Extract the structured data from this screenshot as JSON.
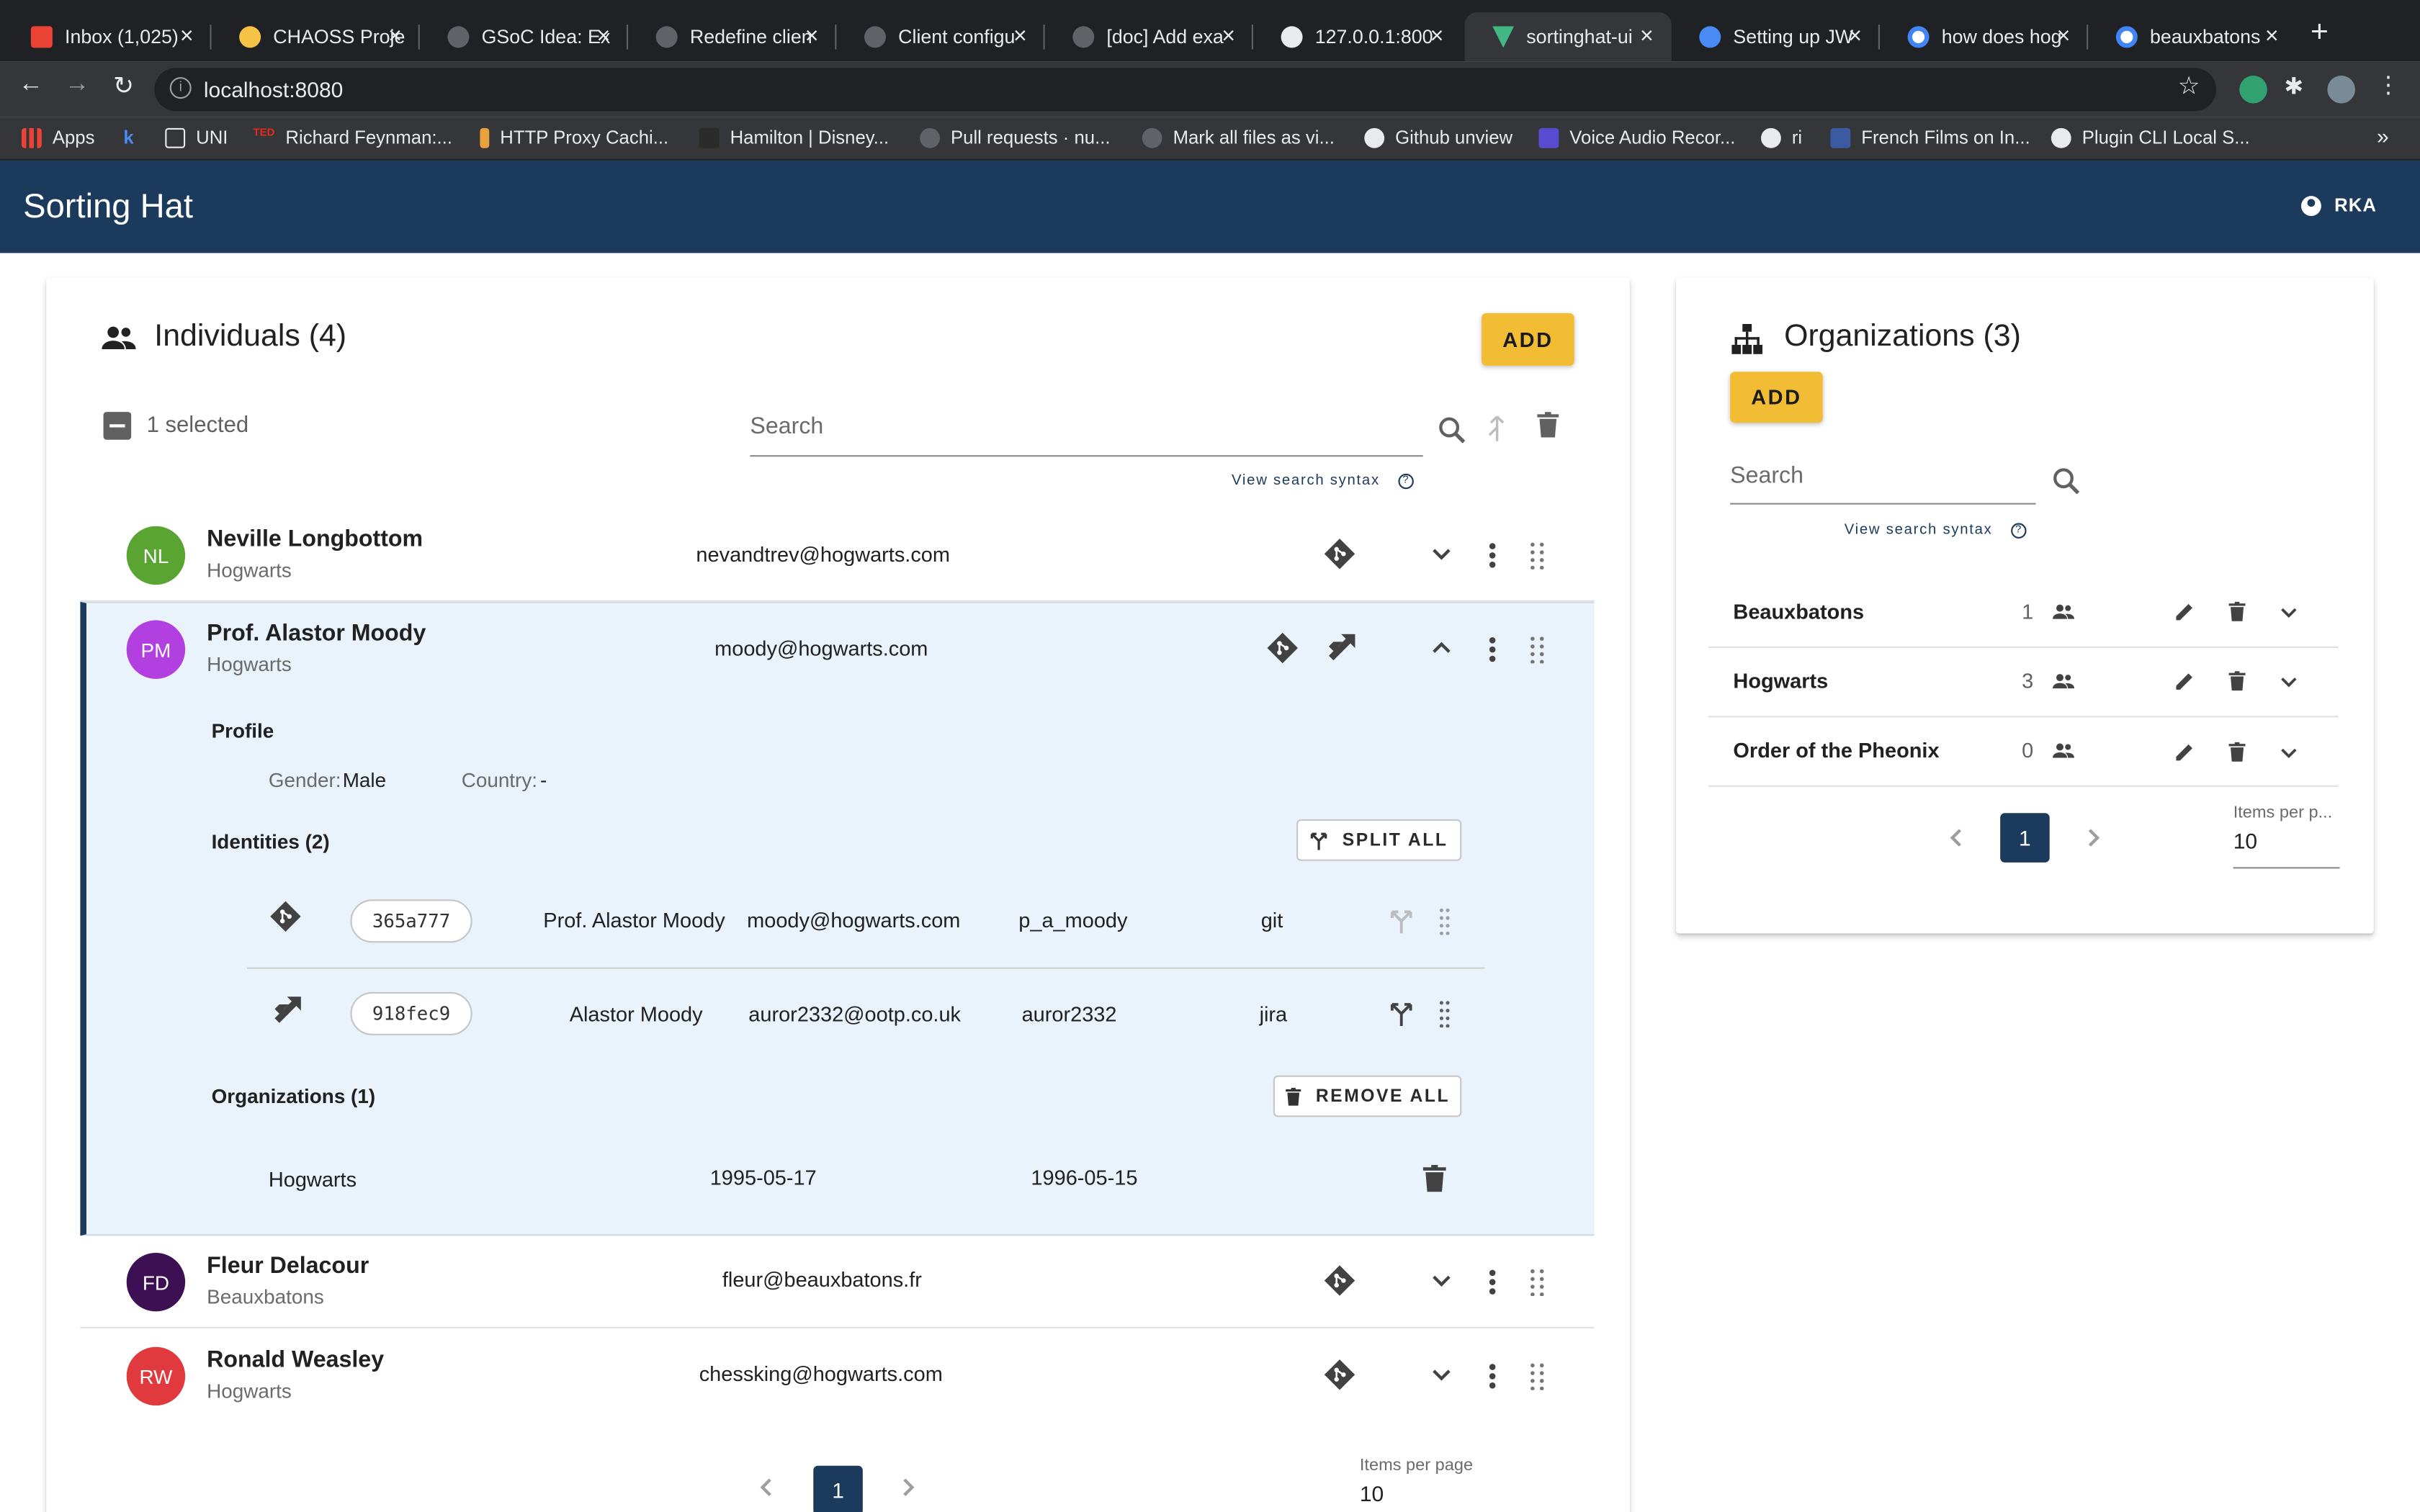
{
  "browser": {
    "tabs": [
      {
        "label": "Inbox (1,025)",
        "icon_color": "#ea4335"
      },
      {
        "label": "CHAOSS Proje",
        "icon_color": "#f6c344"
      },
      {
        "label": "GSoC Idea: Ex",
        "icon_color": "#5f6368"
      },
      {
        "label": "Redefine clien",
        "icon_color": "#5f6368"
      },
      {
        "label": "Client configu",
        "icon_color": "#5f6368"
      },
      {
        "label": "[doc] Add exa",
        "icon_color": "#5f6368"
      },
      {
        "label": "127.0.0.1:800",
        "icon_color": "#e8eaed"
      },
      {
        "label": "sortinghat-ui",
        "icon_color": "#41b883"
      },
      {
        "label": "Setting up JW",
        "icon_color": "#4a8af4"
      },
      {
        "label": "how does hog",
        "icon_color": "#4285f4"
      },
      {
        "label": "beauxbatons",
        "icon_color": "#4285f4"
      }
    ],
    "url": "localhost:8080",
    "bookmarks": [
      {
        "label": "Apps"
      },
      {
        "label": ""
      },
      {
        "label": "UNI"
      },
      {
        "label": "Richard Feynman:..."
      },
      {
        "label": "HTTP Proxy Cachi..."
      },
      {
        "label": "Hamilton | Disney..."
      },
      {
        "label": "Pull requests · nu..."
      },
      {
        "label": "Mark all files as vi..."
      },
      {
        "label": "Github unview"
      },
      {
        "label": "Voice Audio Recor..."
      },
      {
        "label": "ri"
      },
      {
        "label": "French Films on In..."
      },
      {
        "label": "Plugin CLI Local S..."
      }
    ],
    "bookmarks_more": "»"
  },
  "app": {
    "title": "Sorting Hat",
    "user": "RKA"
  },
  "individuals": {
    "title": "Individuals (4)",
    "add_label": "ADD",
    "selected_label": "1 selected",
    "search_placeholder": "Search",
    "search_syntax": "View search syntax",
    "rows": [
      {
        "initials": "NL",
        "name": "Neville Longbottom",
        "org": "Hogwarts",
        "email": "nevandtrev@hogwarts.com",
        "color": "#5aa532"
      },
      {
        "initials": "PM",
        "name": "Prof. Alastor Moody",
        "org": "Hogwarts",
        "email": "moody@hogwarts.com",
        "color": "#b23fe0"
      },
      {
        "initials": "FD",
        "name": "Fleur Delacour",
        "org": "Beauxbatons",
        "email": "fleur@beauxbatons.fr",
        "color": "#3d1053"
      },
      {
        "initials": "RW",
        "name": "Ronald Weasley",
        "org": "Hogwarts",
        "email": "chessking@hogwarts.com",
        "color": "#e0393e"
      }
    ],
    "expanded": {
      "profile_label": "Profile",
      "gender_label": "Gender:",
      "gender_value": "Male",
      "country_label": "Country:",
      "country_value": "-",
      "identities_label": "Identities (2)",
      "split_all": "SPLIT ALL",
      "identities": [
        {
          "uuid": "365a777",
          "name": "Prof. Alastor Moody",
          "email": "moody@hogwarts.com",
          "username": "p_a_moody",
          "source": "git"
        },
        {
          "uuid": "918fec9",
          "name": "Alastor Moody",
          "email": "auror2332@ootp.co.uk",
          "username": "auror2332",
          "source": "jira"
        }
      ],
      "organizations_label": "Organizations (1)",
      "remove_all": "REMOVE ALL",
      "enrollments": [
        {
          "org": "Hogwarts",
          "start": "1995-05-17",
          "end": "1996-05-15"
        }
      ]
    },
    "pagination": {
      "page": "1",
      "items_per_page_label": "Items per page",
      "items_per_page": "10"
    }
  },
  "organizations": {
    "title": "Organizations (3)",
    "add_label": "ADD",
    "search_placeholder": "Search",
    "search_syntax": "View search syntax",
    "rows": [
      {
        "name": "Beauxbatons",
        "count": "1"
      },
      {
        "name": "Hogwarts",
        "count": "3"
      },
      {
        "name": "Order of the Pheonix",
        "count": "0"
      }
    ],
    "pagination": {
      "page": "1",
      "items_per_page_label": "Items per p...",
      "items_per_page": "10"
    }
  }
}
